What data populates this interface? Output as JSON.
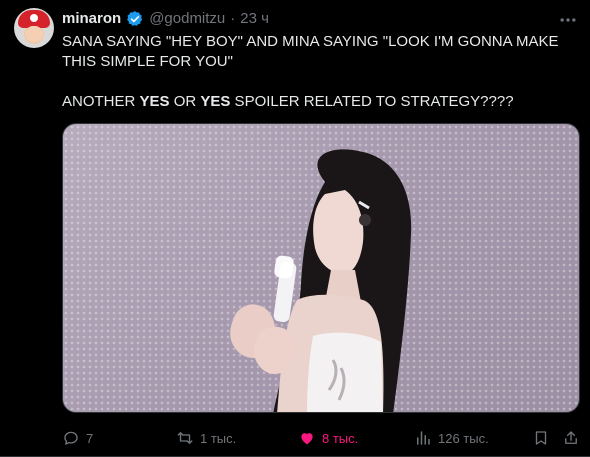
{
  "post": {
    "author_name": "minaron",
    "author_handle": "@godmitzu",
    "separator": "·",
    "time": "23 ч",
    "text_line1": "SANA SAYING \"HEY BOY\" AND MINA SAYING \"LOOK I'M GONNA MAKE THIS SIMPLE FOR YOU\"",
    "text_line2_a": "ANOTHER ",
    "text_line2_b": "YES",
    "text_line2_c": " OR ",
    "text_line2_d": "YES",
    "text_line2_e": " SPOILER RELATED TO STRATEGY????"
  },
  "actions": {
    "replies": "7",
    "reposts": "1 тыс.",
    "likes": "8 тыс.",
    "views": "126 тыс."
  },
  "colors": {
    "background": "#000000",
    "text": "#e7e9ea",
    "muted": "#71767b",
    "like_active": "#f91880",
    "verified": "#1d9bf0"
  },
  "icons": {
    "verified": "verified-badge-icon",
    "more": "more-horizontal-icon",
    "reply": "reply-icon",
    "repost": "repost-icon",
    "like": "heart-filled-icon",
    "views": "views-chart-icon",
    "bookmark": "bookmark-icon",
    "share": "share-icon"
  }
}
